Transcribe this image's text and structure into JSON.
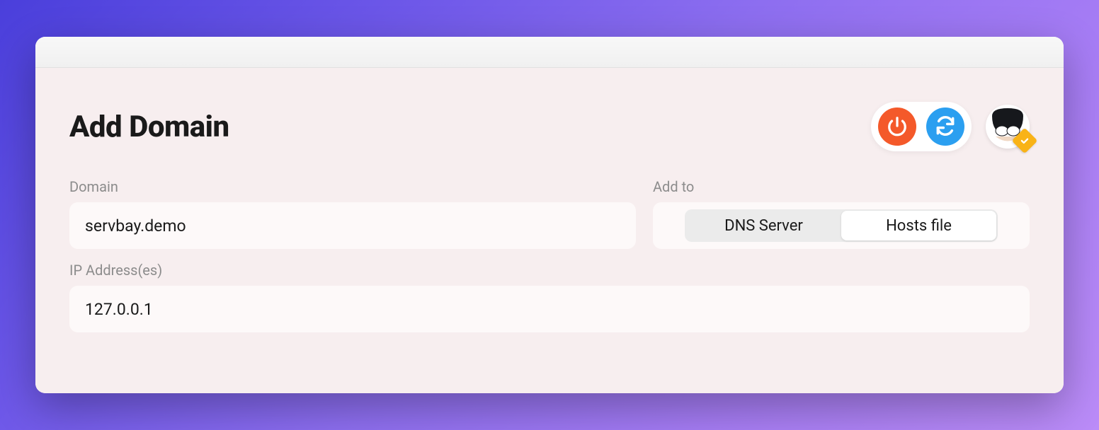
{
  "header": {
    "title": "Add Domain"
  },
  "actions": {
    "power_icon": "power-icon",
    "refresh_icon": "refresh-icon"
  },
  "form": {
    "domain": {
      "label": "Domain",
      "value": "servbay.demo"
    },
    "add_to": {
      "label": "Add to",
      "options": [
        "DNS Server",
        "Hosts file"
      ],
      "selected": "Hosts file"
    },
    "ip": {
      "label": "IP Address(es)",
      "value": "127.0.0.1"
    }
  },
  "colors": {
    "orange": "#f4592a",
    "blue": "#2b9ff0",
    "badge": "#f9b317"
  }
}
